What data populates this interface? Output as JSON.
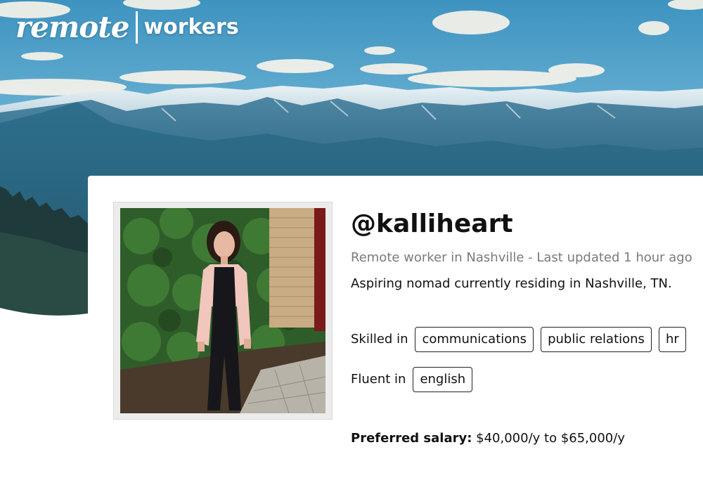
{
  "header": {
    "logo": {
      "script": "remote",
      "word": "workers"
    }
  },
  "profile": {
    "username": "@kalliheart",
    "meta": "Remote worker in Nashville - Last updated 1 hour ago",
    "bio": "Aspiring nomad currently residing in Nashville, TN.",
    "skilled_label": "Skilled in",
    "skills": [
      "communications",
      "public relations",
      "hr"
    ],
    "fluent_label": "Fluent in",
    "languages": [
      "english"
    ],
    "salary_label": "Preferred salary:",
    "salary_value": "$40,000/y to $65,000/y"
  },
  "colors": {
    "sky_top": "#3f97c3",
    "sky_mid": "#8fc9e3",
    "mountain": "#2f6f8f",
    "forest": "#1f3a3a",
    "tag_border": "#222222",
    "muted_text": "#7a7a7a"
  }
}
